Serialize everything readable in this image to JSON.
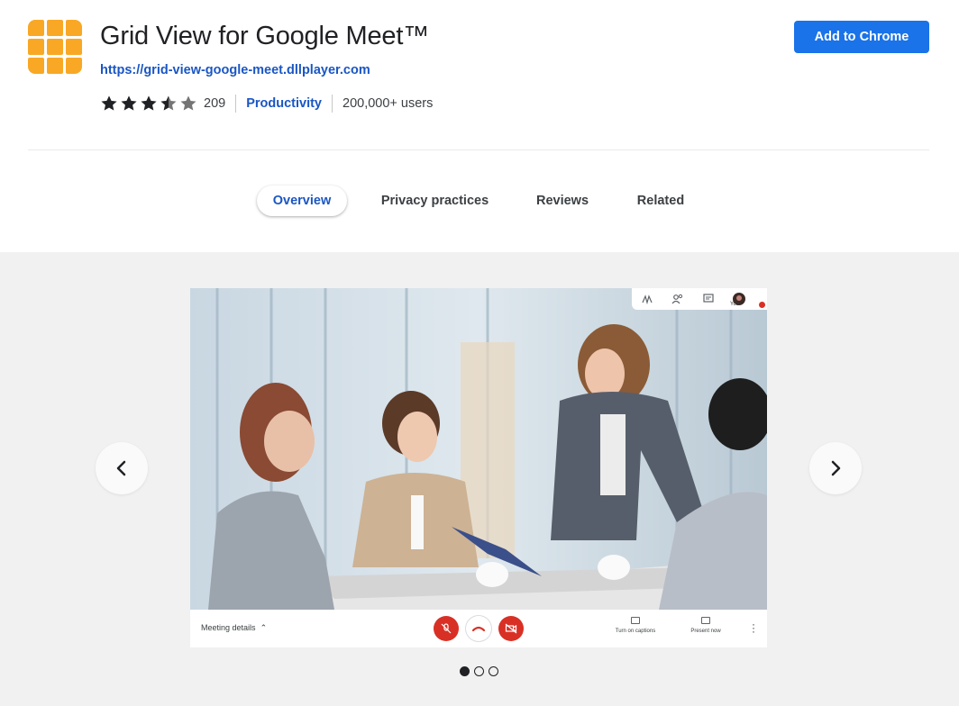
{
  "extension": {
    "title": "Grid View for Google Meet™",
    "website": "https://grid-view-google-meet.dllplayer.com",
    "rating": 3.5,
    "rating_count": "209",
    "category": "Productivity",
    "users": "200,000+ users",
    "add_button": "Add to Chrome",
    "logo_icon": "grid-logo-icon",
    "colors": {
      "accent": "#1a73e8",
      "logo": "#f9a825",
      "link": "#1a56c4"
    }
  },
  "tabs": [
    {
      "label": "Overview",
      "active": true
    },
    {
      "label": "Privacy practices",
      "active": false
    },
    {
      "label": "Reviews",
      "active": false
    },
    {
      "label": "Related",
      "active": false
    }
  ],
  "gallery": {
    "prev_icon": "chevron-left-icon",
    "next_icon": "chevron-right-icon",
    "slides_total": 3,
    "current_slide": 1,
    "slide": {
      "you_label": "You",
      "meeting_details": "Meeting details",
      "captions_label": "Turn on captions",
      "present_label": "Present now"
    }
  }
}
